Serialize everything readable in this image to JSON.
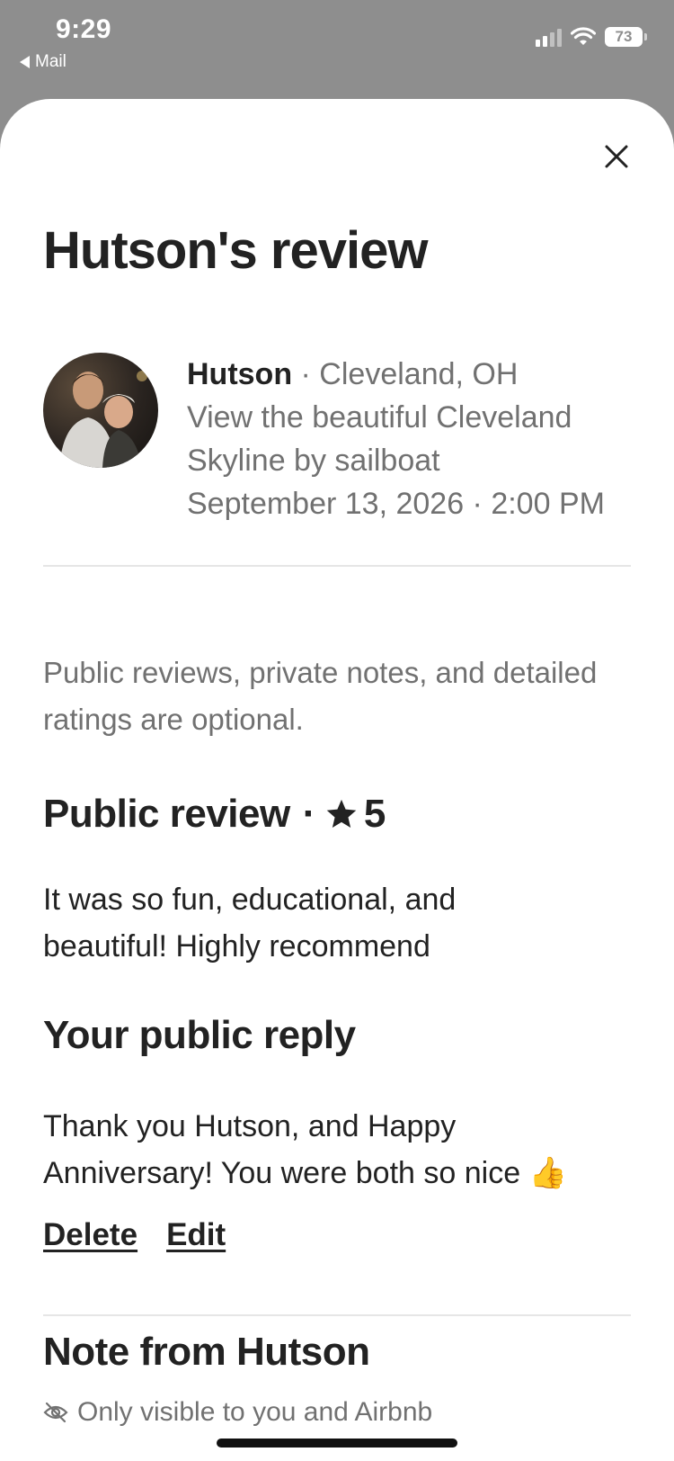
{
  "status_bar": {
    "time": "9:29",
    "back_app": "Mail",
    "battery": "73"
  },
  "sheet": {
    "title": "Hutson's review",
    "reviewer": {
      "name": "Hutson",
      "location": " · Cleveland, OH",
      "experience": "View the beautiful Cleveland Skyline by sailboat",
      "datetime": "September 13, 2026 · 2:00 PM"
    },
    "optional_note": "Public reviews, private notes, and detailed ratings are optional.",
    "public_review": {
      "heading": "Public review",
      "separator": "·",
      "rating": "5",
      "text": "It was so fun, educational, and beautiful! Highly recommend"
    },
    "public_reply": {
      "heading": "Your public reply",
      "text": "Thank you Hutson, and Happy Anniversary! You were both so nice 👍",
      "delete_label": "Delete",
      "edit_label": "Edit"
    },
    "private_note": {
      "heading": "Note from Hutson",
      "visibility": "Only visible to you and Airbnb"
    }
  },
  "colors": {
    "text_primary": "#222222",
    "text_secondary": "#717171",
    "divider": "#e6e6e6",
    "backdrop": "#8e8e8e"
  },
  "icons": [
    "back-arrow-icon",
    "signal-icon",
    "wifi-icon",
    "battery-icon",
    "close-icon",
    "star-icon",
    "eye-off-icon"
  ]
}
